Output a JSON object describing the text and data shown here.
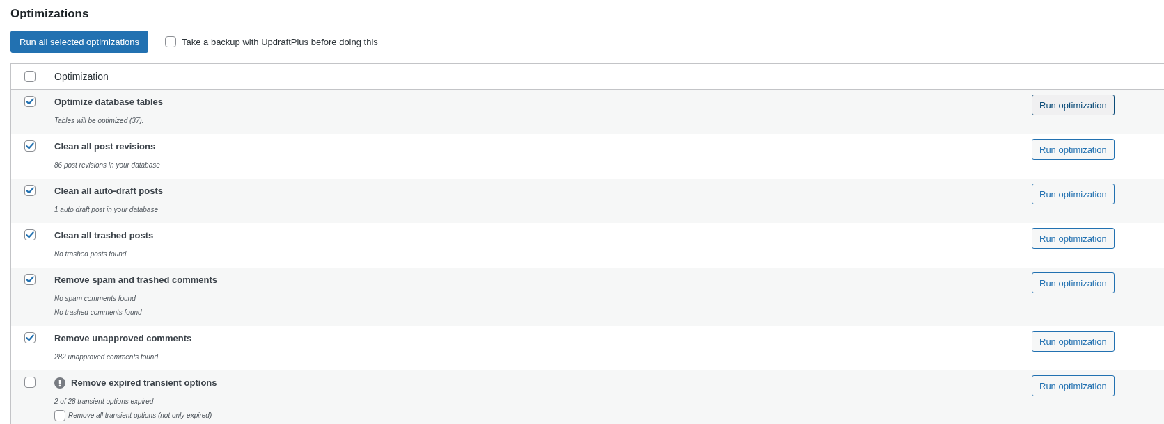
{
  "title": "Optimizations",
  "toolbar": {
    "run_all_button": "Run all selected optimizations",
    "backup": {
      "label": "Take a backup with UpdraftPlus before doing this",
      "checked": false
    }
  },
  "table": {
    "header": {
      "checked": false,
      "column": "Optimization"
    },
    "rows": [
      {
        "checked": true,
        "warning": false,
        "title": "Optimize database tables",
        "details": [
          "Tables will be optimized (37)."
        ],
        "button": "Run optimization",
        "focused": true
      },
      {
        "checked": true,
        "warning": false,
        "title": "Clean all post revisions",
        "details": [
          "86 post revisions in your database"
        ],
        "button": "Run optimization",
        "focused": false
      },
      {
        "checked": true,
        "warning": false,
        "title": "Clean all auto-draft posts",
        "details": [
          "1 auto draft post in your database"
        ],
        "button": "Run optimization",
        "focused": false
      },
      {
        "checked": true,
        "warning": false,
        "title": "Clean all trashed posts",
        "details": [
          "No trashed posts found"
        ],
        "button": "Run optimization",
        "focused": false
      },
      {
        "checked": true,
        "warning": false,
        "title": "Remove spam and trashed comments",
        "details": [
          "No spam comments found",
          "No trashed comments found"
        ],
        "button": "Run optimization",
        "focused": false
      },
      {
        "checked": true,
        "warning": false,
        "title": "Remove unapproved comments",
        "details": [
          "282 unapproved comments found"
        ],
        "button": "Run optimization",
        "focused": false
      },
      {
        "checked": false,
        "warning": true,
        "title": "Remove expired transient options",
        "details": [
          "2 of 28 transient options expired"
        ],
        "option": {
          "label": "Remove all transient options (not only expired)",
          "checked": false
        },
        "button": "Run optimization",
        "focused": false
      }
    ]
  }
}
